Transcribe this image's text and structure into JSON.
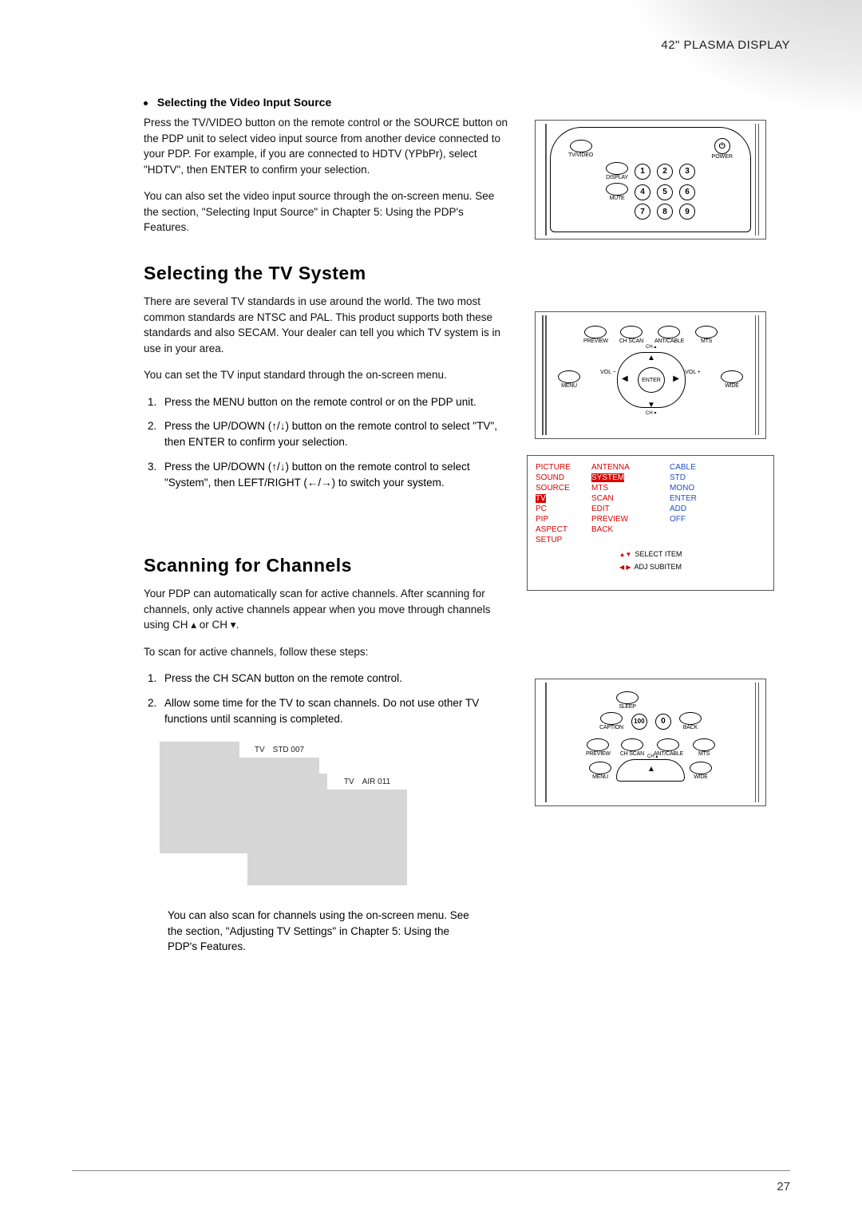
{
  "header": {
    "product": "42\" PLASMA DISPLAY"
  },
  "sec_video": {
    "title": "Selecting the Video Input Source",
    "p1": "Press the TV/VIDEO button on the remote control or the SOURCE button on the PDP unit to select video input source from another device connected to your PDP. For example, if you are connected to HDTV (YPbPr), select \"HDTV\", then ENTER to confirm your selection.",
    "p2": "You can also set the video input source through the on-screen menu. See the section, \"Selecting Input Source\" in Chapter 5: Using the PDP's Features."
  },
  "sec_tvsys": {
    "title": "Selecting  the TV  System",
    "p1": "There are several TV standards in use around the world. The two most common standards are NTSC and PAL. This product supports both these standards and also SECAM. Your dealer can tell you which TV system is in use in your area.",
    "p2": "You can set the TV input standard through the on-screen menu.",
    "steps": [
      "Press the MENU button on the remote control or on the PDP unit.",
      "Press the UP/DOWN (↑/↓) button on the remote control to select \"TV\", then ENTER to confirm your selection.",
      "Press the UP/DOWN (↑/↓) button on the remote control to select \"System\", then LEFT/RIGHT (←/→) to switch your system."
    ]
  },
  "sec_scan": {
    "title": "Scanning  for  Channels",
    "p1": "Your PDP can automatically scan for active channels. After scanning for channels, only active channels appear when you move through channels using CH ▴ or CH ▾.",
    "p2": "To scan for active channels, follow these steps:",
    "steps": [
      "Press the CH SCAN button on the remote control.",
      "Allow some time for the TV to scan channels. Do not use other TV functions until scanning is completed."
    ],
    "screen_a": {
      "src": "TV",
      "ch": "STD 007"
    },
    "screen_b": {
      "src": "TV",
      "ch": "AIR 011"
    },
    "foot": "You can also scan for channels using the on-screen menu. See the section, \"Adjusting TV Settings\" in Chapter 5: Using the PDP's Features."
  },
  "remote1": {
    "labels": {
      "tvvideo": "TV/VIDEO",
      "power": "POWER",
      "display": "DISPLAY",
      "mute": "MUTE"
    },
    "keys": [
      "1",
      "2",
      "3",
      "4",
      "5",
      "6",
      "7",
      "8",
      "9"
    ]
  },
  "remote2": {
    "row1": [
      "PREVIEW",
      "CH SCAN",
      "ANT/CABLE",
      "MTS"
    ],
    "menu": "MENU",
    "wide": "WIDE",
    "enter": "ENTER",
    "ch_up": "CH ▴",
    "ch_dn": "CH ▾",
    "vol_dn": "VOL\n−",
    "vol_up": "VOL\n+"
  },
  "remote3": {
    "topRow": [
      "SLEEP"
    ],
    "midKeys": [
      "100",
      "0"
    ],
    "caption": "CAPTION",
    "back": "BACK",
    "row2": [
      "PREVIEW",
      "CH SCAN",
      "ANT/CABLE",
      "MTS"
    ],
    "menu": "MENU",
    "wide": "WIDE",
    "ch_up": "CH ▴"
  },
  "osd": {
    "col1": [
      "PICTURE",
      "SOUND",
      "SOURCE",
      "TV",
      "PC",
      "PIP",
      "ASPECT",
      "SETUP"
    ],
    "col2": [
      "ANTENNA",
      "SYSTEM",
      "MTS",
      "SCAN",
      "EDIT",
      "PREVIEW",
      "BACK"
    ],
    "col3": [
      "CABLE",
      "STD",
      "MONO",
      "ENTER",
      "ADD",
      "OFF"
    ],
    "sel_col1_idx": 3,
    "sel_col2_idx": 1,
    "hint1": "SELECT  ITEM",
    "hint2": "ADJ  SUBITEM"
  },
  "page_number": "27"
}
